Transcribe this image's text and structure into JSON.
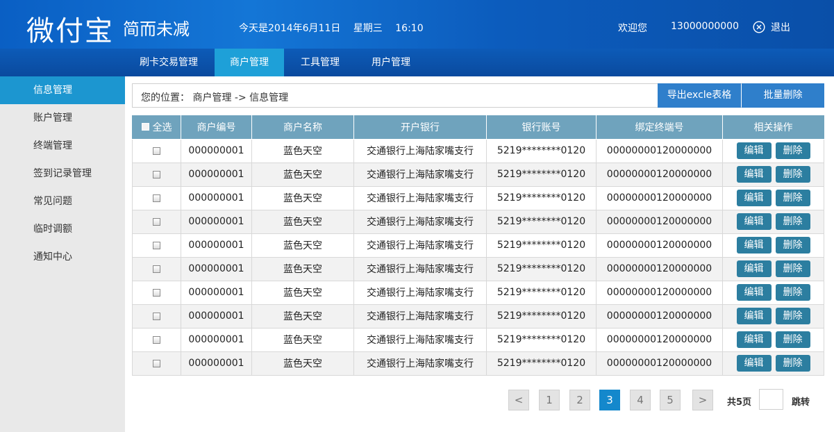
{
  "header": {
    "logo": "微付宝",
    "slogan": "简而未减",
    "date": "今天是2014年6月11日",
    "weekday": "星期三",
    "time": "16:10",
    "welcome": "欢迎您",
    "phone": "13000000000",
    "logout": "退出"
  },
  "nav": {
    "items": [
      {
        "label": "刷卡交易管理"
      },
      {
        "label": "商户管理"
      },
      {
        "label": "工具管理"
      },
      {
        "label": "用户管理"
      }
    ],
    "active": "商户管理"
  },
  "sidebar": {
    "items": [
      {
        "label": "信息管理"
      },
      {
        "label": "账户管理"
      },
      {
        "label": "终端管理"
      },
      {
        "label": "签到记录管理"
      },
      {
        "label": "常见问题"
      },
      {
        "label": "临时调额"
      },
      {
        "label": "通知中心"
      }
    ],
    "active": "信息管理"
  },
  "breadcrumb": {
    "text": "您的位置： 商户管理 -> 信息管理"
  },
  "toolbar": {
    "export_label": "导出excle表格",
    "batch_delete_label": "批量删除"
  },
  "table": {
    "select_all": "全选",
    "headers": [
      "商户编号",
      "商户名称",
      "开户银行",
      "银行账号",
      "绑定终端号",
      "相关操作"
    ],
    "edit_label": "编辑",
    "delete_label": "删除",
    "rows": [
      [
        "000000001",
        "蓝色天空",
        "交通银行上海陆家嘴支行",
        "5219********0120",
        "00000000120000000"
      ],
      [
        "000000001",
        "蓝色天空",
        "交通银行上海陆家嘴支行",
        "5219********0120",
        "00000000120000000"
      ],
      [
        "000000001",
        "蓝色天空",
        "交通银行上海陆家嘴支行",
        "5219********0120",
        "00000000120000000"
      ],
      [
        "000000001",
        "蓝色天空",
        "交通银行上海陆家嘴支行",
        "5219********0120",
        "00000000120000000"
      ],
      [
        "000000001",
        "蓝色天空",
        "交通银行上海陆家嘴支行",
        "5219********0120",
        "00000000120000000"
      ],
      [
        "000000001",
        "蓝色天空",
        "交通银行上海陆家嘴支行",
        "5219********0120",
        "00000000120000000"
      ],
      [
        "000000001",
        "蓝色天空",
        "交通银行上海陆家嘴支行",
        "5219********0120",
        "00000000120000000"
      ],
      [
        "000000001",
        "蓝色天空",
        "交通银行上海陆家嘴支行",
        "5219********0120",
        "00000000120000000"
      ],
      [
        "000000001",
        "蓝色天空",
        "交通银行上海陆家嘴支行",
        "5219********0120",
        "00000000120000000"
      ],
      [
        "000000001",
        "蓝色天空",
        "交通银行上海陆家嘴支行",
        "5219********0120",
        "00000000120000000"
      ]
    ]
  },
  "pagination": {
    "prev": "<",
    "next": ">",
    "pages": [
      "1",
      "2",
      "3",
      "4",
      "5"
    ],
    "current": "3",
    "total": "共5页",
    "jump": "跳转"
  },
  "colors": {
    "header_bg": "#1476d6",
    "nav_active": "#1ea0d8",
    "sidebar_active": "#1c96d0",
    "table_header": "#6fa3bd",
    "op_button": "#2c7ea0",
    "page_active": "#1488cc"
  },
  "icons": {
    "logout": "close-circle-icon"
  }
}
